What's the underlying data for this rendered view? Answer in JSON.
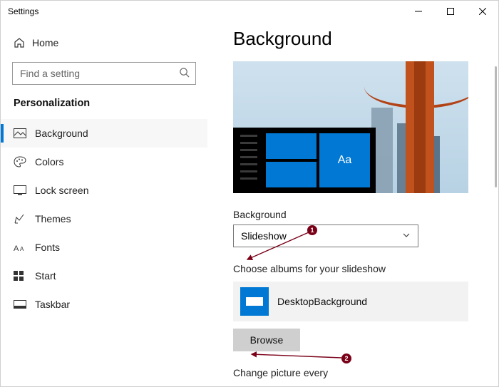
{
  "window": {
    "title": "Settings"
  },
  "sidebar": {
    "home_label": "Home",
    "search_placeholder": "Find a setting",
    "section": "Personalization",
    "items": [
      {
        "label": "Background"
      },
      {
        "label": "Colors"
      },
      {
        "label": "Lock screen"
      },
      {
        "label": "Themes"
      },
      {
        "label": "Fonts"
      },
      {
        "label": "Start"
      },
      {
        "label": "Taskbar"
      }
    ]
  },
  "main": {
    "title": "Background",
    "preview_tile_text": "Aa",
    "bg_label": "Background",
    "bg_value": "Slideshow",
    "albums_label": "Choose albums for your slideshow",
    "album_name": "DesktopBackground",
    "browse_label": "Browse",
    "change_every_label": "Change picture every"
  },
  "annotations": {
    "m1": "1",
    "m2": "2"
  }
}
